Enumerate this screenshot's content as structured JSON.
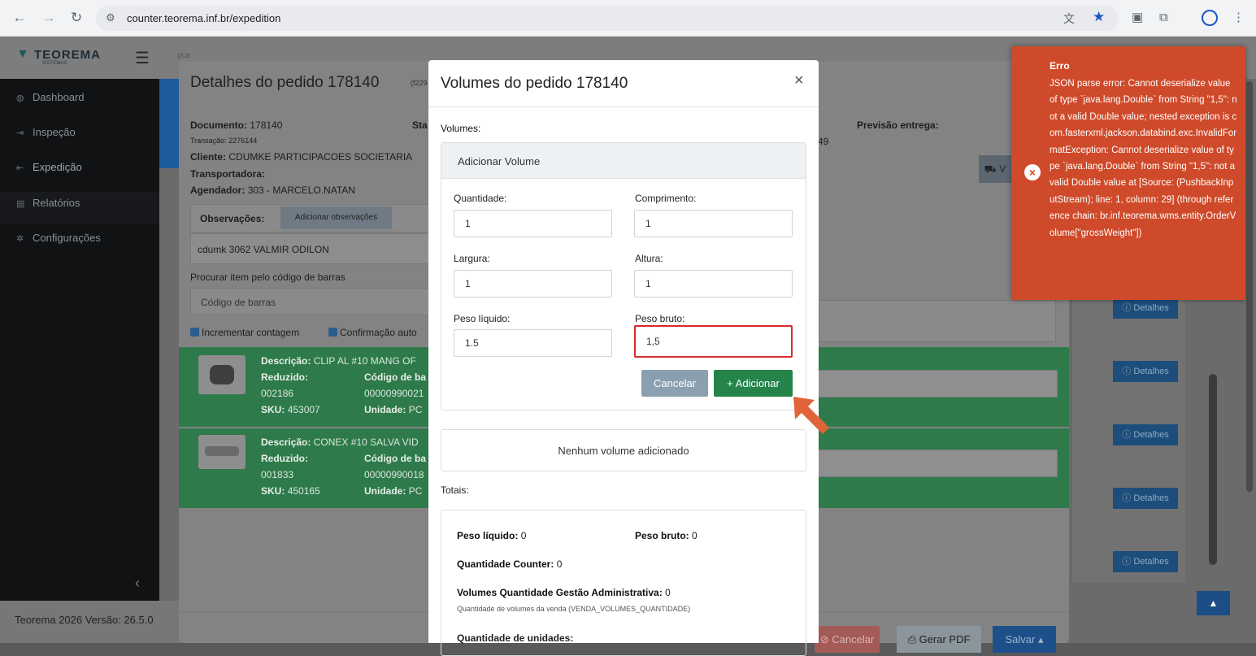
{
  "browser": {
    "url": "counter.teorema.inf.br/expedition"
  },
  "app": {
    "logo": "TEOREMA",
    "logo_sub": "SISTEMAS",
    "topbar_left": "pca",
    "sidebar": {
      "items": [
        {
          "label": "Dashboard",
          "icon": "dashboard-icon"
        },
        {
          "label": "Inspeção",
          "icon": "sign-in-icon"
        },
        {
          "label": "Expedição",
          "icon": "sign-out-icon"
        },
        {
          "label": "Relatórios",
          "icon": "file-icon"
        },
        {
          "label": "Configurações",
          "icon": "gear-icon"
        }
      ]
    },
    "footer": "Teorema 2026 Versão: 26.5.0"
  },
  "base_modal": {
    "title": "Detalhes do pedido 178140",
    "subtitle": "(f229",
    "documento_label": "Documento:",
    "documento_value": "178140",
    "transacao": "Transação: 2276144",
    "cliente_label": "Cliente:",
    "cliente_value": "CDUMKE PARTICIPACOES SOCIETARIA",
    "transportadora_label": "Transportadora:",
    "agendador_label": "Agendador:",
    "agendador_value": "303 - MARCELO.NATAN",
    "status_label": "Sta",
    "previsao_label": "Previsão entrega:",
    "partial_number": "49",
    "truck_btn": "V",
    "obs_label": "Observações:",
    "obs_button": "Adicionar observações",
    "obs_text": "cdumk 3062 VALMIR ODILON",
    "barcode_label": "Procurar item pelo código de barras",
    "barcode_placeholder": "Código de barras",
    "check_incrementar": "Incrementar contagem",
    "check_confirmacao": "Confirmação auto",
    "items": [
      {
        "descricao_label": "Descrição:",
        "descricao": "CLIP AL #10 MANG OF",
        "reduzido_label": "Reduzido:",
        "reduzido": "002186",
        "codigo_label": "Código de ba",
        "codigo": "00000990021",
        "sku_label": "SKU:",
        "sku": "453007",
        "unidade_label": "Unidade:",
        "unidade": "PC"
      },
      {
        "descricao_label": "Descrição:",
        "descricao": "CONEX #10 SALVA VID",
        "reduzido_label": "Reduzido:",
        "reduzido": "001833",
        "codigo_label": "Código de ba",
        "codigo": "00000990018",
        "sku_label": "SKU:",
        "sku": "450165",
        "unidade_label": "Unidade:",
        "unidade": "PC"
      }
    ],
    "detalhes_label": "Detalhes",
    "cancelar": "Cancelar",
    "gerar_pdf": "Gerar PDF",
    "salvar": "Salvar"
  },
  "volumes_modal": {
    "title": "Volumes do pedido 178140",
    "close": "×",
    "volumes_label": "Volumes:",
    "add_card_title": "Adicionar Volume",
    "fields": {
      "quantidade": {
        "label": "Quantidade:",
        "value": "1"
      },
      "comprimento": {
        "label": "Comprimento:",
        "value": "1"
      },
      "largura": {
        "label": "Largura:",
        "value": "1"
      },
      "altura": {
        "label": "Altura:",
        "value": "1"
      },
      "peso_liquido": {
        "label": "Peso líquido:",
        "value": "1.5"
      },
      "peso_bruto": {
        "label": "Peso bruto:",
        "value": "1,5"
      }
    },
    "cancel_button": "Cancelar",
    "add_button": "+ Adicionar",
    "empty_text": "Nenhum volume adicionado",
    "totals_label": "Totais:",
    "totals": {
      "peso_liquido_label": "Peso líquido:",
      "peso_liquido": "0",
      "peso_bruto_label": "Peso bruto:",
      "peso_bruto": "0",
      "qtd_counter_label": "Quantidade Counter:",
      "qtd_counter": "0",
      "vol_gestao_label": "Volumes Quantidade Gestão Administrativa:",
      "vol_gestao": "0",
      "vol_gestao_note": "Quantidade de volumes da venda (VENDA_VOLUMES_QUANTIDADE)",
      "qtd_unidades_label": "Quantidade de unidades:"
    }
  },
  "error_toast": {
    "title": "Erro",
    "message": "JSON parse error: Cannot deserialize value of type `java.lang.Double` from String \"1,5\": not a valid Double value; nested exception is com.fasterxml.jackson.databind.exc.InvalidFormatException: Cannot deserialize value of type `java.lang.Double` from String \"1,5\": not a valid Double value at [Source: (PushbackInputStream); line: 1, column: 29] (through reference chain: br.inf.teorema.wms.entity.OrderVolume[\"grossWeight\"])",
    "icon": "error-circle-icon",
    "color": "#cf4a2a"
  }
}
